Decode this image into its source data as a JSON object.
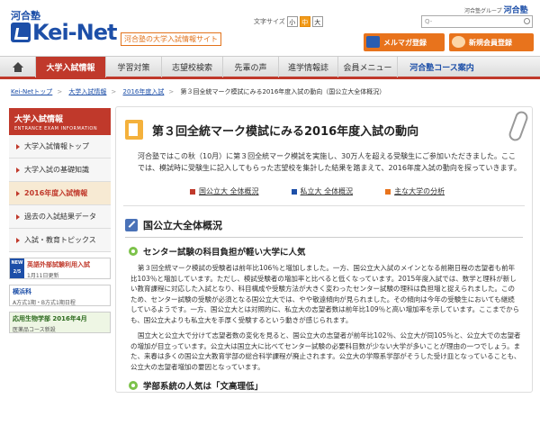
{
  "header": {
    "kawai_small": "河合塾",
    "logo_text": "Kei-Net",
    "logo_sub": "河合塾の大学入試情報サイト",
    "fontsize_label": "文字サイズ",
    "fontsize_options": [
      "小",
      "中",
      "大"
    ],
    "group_label": "河合塾グループ",
    "group_name": "河合塾",
    "search_placeholder": "Q-",
    "mailmag_label": "メルマガ登録",
    "new_member_label": "新規会員登録"
  },
  "nav": {
    "items": [
      "大学入試情報",
      "学習対策",
      "志望校検索",
      "先輩の声",
      "進学情報誌",
      "会員メニュー",
      "河合塾コース案内"
    ]
  },
  "breadcrumb": [
    "Kei-Netトップ",
    "大学入試情報",
    "2016年度入試",
    "第３回全統マーク模試にみる2016年度入試の動向（国公立大全体概況）"
  ],
  "sidebar": {
    "title": "大学入試情報",
    "subtitle": "ENTRANCE EXAM INFORMATION",
    "items": [
      "大学入試情報トップ",
      "大学入試の基礎知識",
      "2016年度入試情報",
      "過去の入試結果データ",
      "入試・教育トピックス"
    ],
    "banners": [
      {
        "tag": "NEW 2/5",
        "title": "英語外部試験利用入試",
        "line2": "1月11日更新"
      },
      {
        "title": "横浜科",
        "line2": "A方式1期・B方式1期日程"
      },
      {
        "title": "応用生物学部 2016年4月",
        "line2": "医薬品コース新設"
      }
    ]
  },
  "main": {
    "title": "第３回全統マーク模試にみる2016年度入試の動向",
    "intro": "河合塾ではこの秋（10月）に第３回全統マーク模試を実施し、30万人を超える受験生にご参加いただきました。ここでは、模試時に受験生に記入してもらった志望校を集計した結果を踏まえて、2016年度入試の動向を探っていきます。",
    "anchors": [
      "国公立大 全体概況",
      "私立大 全体概況",
      "主な大学の分析"
    ],
    "section_title": "国公立大全体概況",
    "sub1": "センター試験の科目負担が軽い大学に人気",
    "para1": "第３回全統マーク模試の受験者は前年比106％と増加しました。一方、国公立大入試のメインとなる前期日程の志望者も前年比103％と増加しています。ただし、模試受験者の増加率と比べると低くなっています。2015年度入試では、数学と理科が新しい教育課程に対応した入試となり、科目構成や受験方法が大きく変わったセンター試験の理科は負担増と捉えられました。このため、センター試験の受験が必須となる国公立大では、やや敬遠傾向が見られました。その傾向は今年の受験生においても継続しているようです。一方、国公立大とは対照的に、私立大の志望者数は前年比109％と高い増加率を示しています。ここまでからも、国公立大よりも私立大を手厚く受験するという動きが感じられます。",
    "para2": "国立大と公立大で分けて志望者数の変化を見ると、国公立大の志望者が前年比102％、公立大が同105％と、公立大での志望者の増加が目立っています。公立大は国立大に比べてセンター試験の必要科目数が少ない大学が多いことが理由の一つでしょう。また、来春は多くの国公立大教育学部の総合科学課程が廃止されます。公立大の学際系学部がそうした受け皿となっていることも、公立大の志望者増加の要因となっています。",
    "sub2": "学部系統の人気は「文高理低」"
  },
  "colors": {
    "brand_blue": "#1d4fa8",
    "accent_red": "#c0392b",
    "orange": "#e8731c"
  }
}
